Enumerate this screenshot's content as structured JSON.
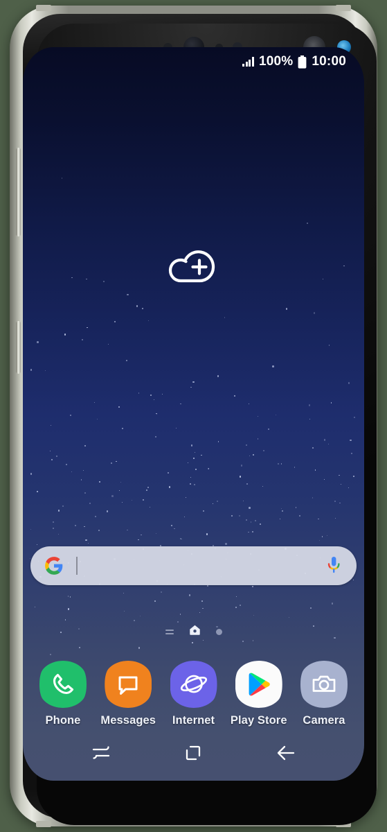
{
  "device": {
    "name": "samsung-galaxy-s8",
    "frame_color": "#c9cbc0",
    "bezel_color": "#0a0a0a"
  },
  "status_bar": {
    "signal_icon": "signal-bars-icon",
    "battery_percent": "100%",
    "battery_icon": "battery-full-icon",
    "clock": "10:00"
  },
  "wallpaper": {
    "name": "night-sky-gradient",
    "top_color": "#070b24",
    "bottom_color": "#465070"
  },
  "widget": {
    "name": "add-cloud-widget",
    "icon": "cloud-plus-icon",
    "color": "#ffffff"
  },
  "search": {
    "name": "google-search-bar",
    "placeholder": "",
    "value": "",
    "logo_icon": "google-g-icon",
    "mic_icon": "microphone-icon",
    "background": "#d8dbe7"
  },
  "page_indicator": {
    "pages": [
      {
        "name": "app-list-page",
        "icon": "lines-icon",
        "active": false
      },
      {
        "name": "home-page",
        "icon": "home-icon",
        "active": true
      },
      {
        "name": "widget-page",
        "icon": "dot-icon",
        "active": false
      }
    ]
  },
  "dock": {
    "apps": [
      {
        "label": "Phone",
        "icon": "phone-icon",
        "bg": "#20bf6b"
      },
      {
        "label": "Messages",
        "icon": "message-icon",
        "bg": "#f0821e"
      },
      {
        "label": "Internet",
        "icon": "internet-icon",
        "bg": "#6c63e8"
      },
      {
        "label": "Play Store",
        "icon": "play-store-icon",
        "bg": "#fbfbfb"
      },
      {
        "label": "Camera",
        "icon": "camera-icon",
        "bg": "#a8b2cf"
      }
    ]
  },
  "nav_bar": {
    "buttons": [
      {
        "name": "recents-button",
        "icon": "recents-icon"
      },
      {
        "name": "home-button",
        "icon": "home-square-icon"
      },
      {
        "name": "back-button",
        "icon": "back-arrow-icon"
      }
    ]
  }
}
